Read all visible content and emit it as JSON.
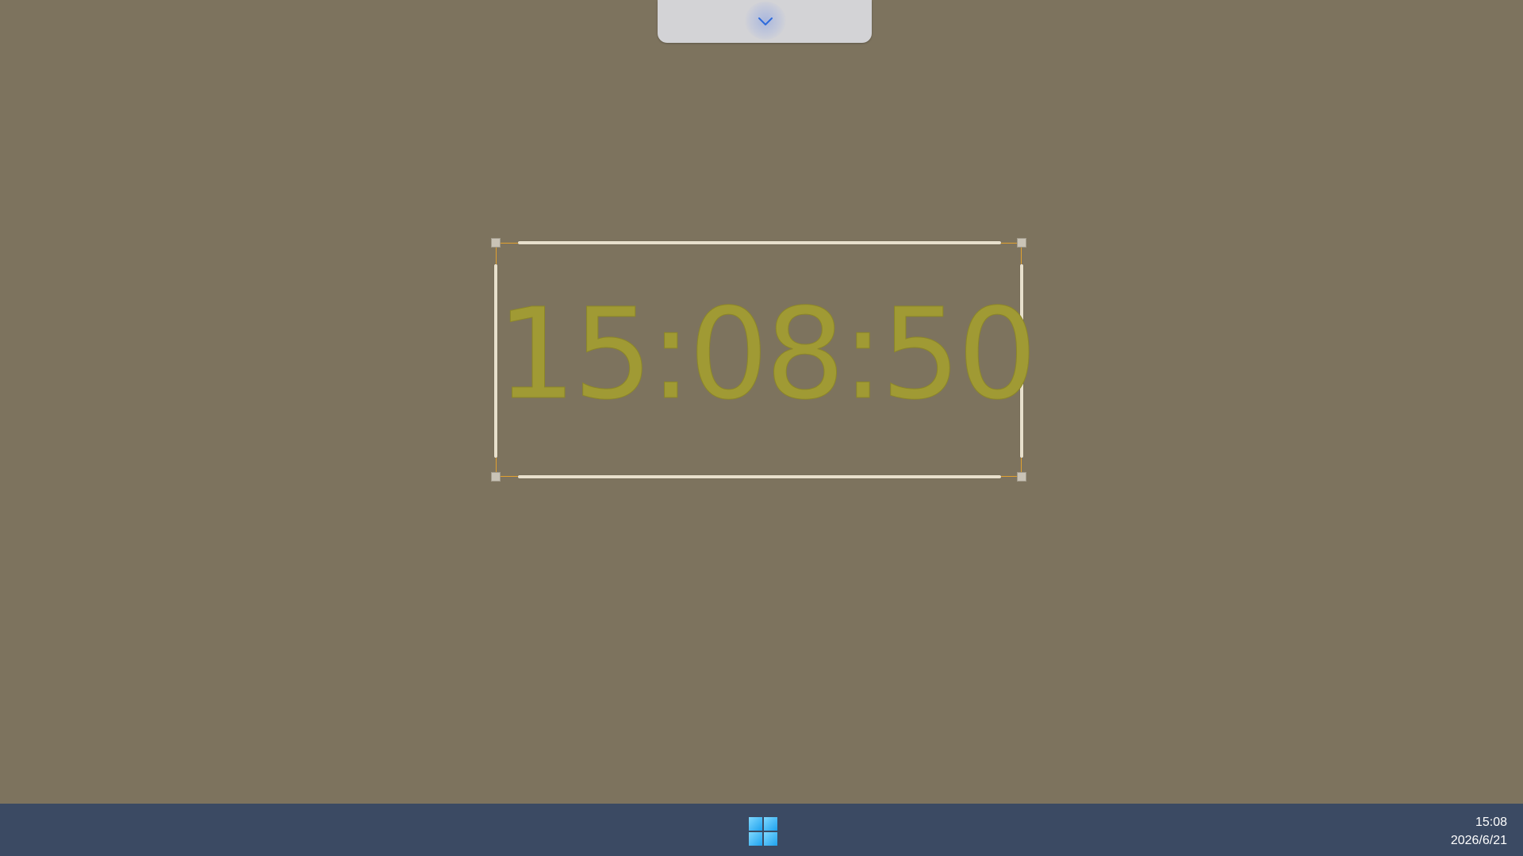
{
  "clock": {
    "time": "15:08:50",
    "color": "#a09a34"
  },
  "top_tab": {
    "icon": "chevron-down-icon"
  },
  "taskbar": {
    "start_icon": "windows-logo-icon",
    "tray_time": "15:08",
    "tray_date": "2026/6/21"
  },
  "colors": {
    "desktop_background": "#7d735e",
    "taskbar_background": "#3b4a63",
    "selection_border": "#e0a030",
    "chevron": "#2e6bdc"
  }
}
